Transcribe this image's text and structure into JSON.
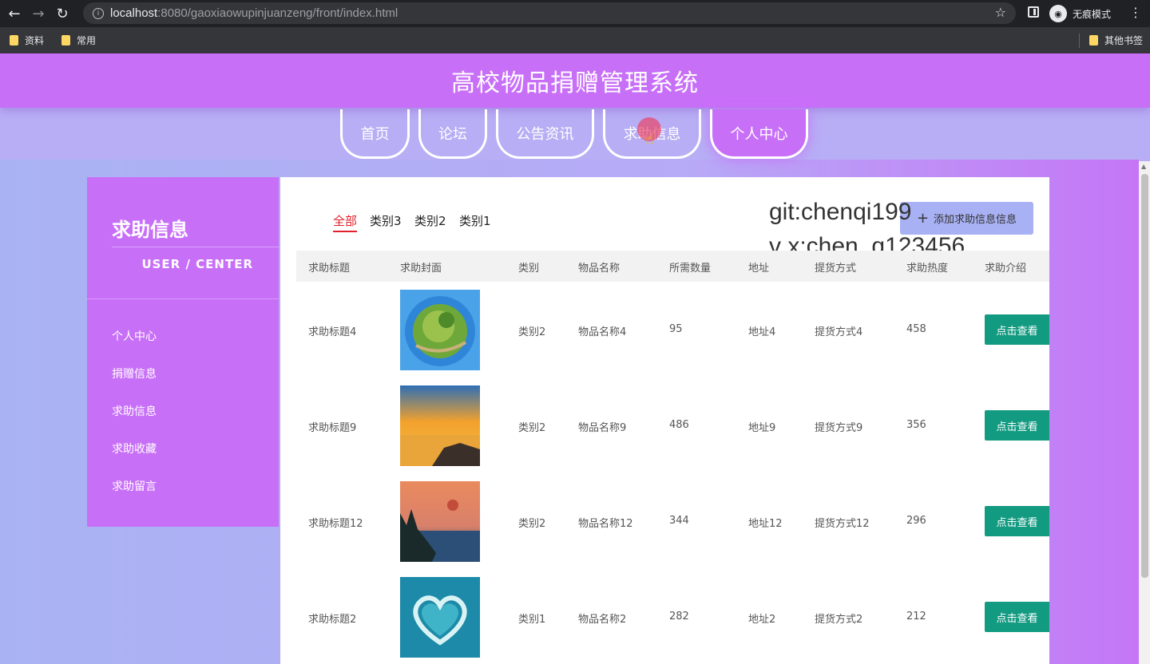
{
  "browser": {
    "url_host": "localhost",
    "url_rest": ":8080/gaoxiaowupinjuanzeng/front/index.html",
    "incognito_label": "无痕模式",
    "bookmarks": [
      "资料",
      "常用"
    ],
    "other_bookmarks": "其他书签"
  },
  "header": {
    "title": "高校物品捐赠管理系统"
  },
  "nav": {
    "tabs": [
      {
        "label": "首页"
      },
      {
        "label": "论坛"
      },
      {
        "label": "公告资讯"
      },
      {
        "label": "求助信息"
      },
      {
        "label": "个人中心",
        "active": true
      }
    ]
  },
  "sidebar": {
    "title": "求助信息",
    "subtitle": "USER / CENTER",
    "items": [
      "个人中心",
      "捐赠信息",
      "求助信息",
      "求助收藏",
      "求助留言"
    ]
  },
  "filters": {
    "items": [
      "全部",
      "类别3",
      "类别2",
      "类别1"
    ],
    "active": "全部"
  },
  "add_button": "添加求助信息信息",
  "watermark": {
    "line1": "git:chenqi199",
    "line2": "v x:chen_q123456"
  },
  "table": {
    "headers": [
      "求助标题",
      "求助封面",
      "类别",
      "物品名称",
      "所需数量",
      "地址",
      "提货方式",
      "求助热度",
      "求助介绍"
    ],
    "rows": [
      {
        "title": "求助标题4",
        "image": "planet",
        "category": "类别2",
        "name": "物品名称4",
        "qty": "95",
        "addr": "地址4",
        "pickup": "提货方式4",
        "heat": "458",
        "action": "点击查看"
      },
      {
        "title": "求助标题9",
        "image": "sunset",
        "category": "类别2",
        "name": "物品名称9",
        "qty": "486",
        "addr": "地址9",
        "pickup": "提货方式9",
        "heat": "356",
        "action": "点击查看"
      },
      {
        "title": "求助标题12",
        "image": "lake",
        "category": "类别2",
        "name": "物品名称12",
        "qty": "344",
        "addr": "地址12",
        "pickup": "提货方式12",
        "heat": "296",
        "action": "点击查看"
      },
      {
        "title": "求助标题2",
        "image": "heart-island",
        "category": "类别1",
        "name": "物品名称2",
        "qty": "282",
        "addr": "地址2",
        "pickup": "提货方式2",
        "heat": "212",
        "action": "点击查看"
      }
    ]
  },
  "colors": {
    "brand": "#c86ff8",
    "view_button": "#139b82",
    "add_button": "#a8b1f3",
    "filter_active": "#e0202a"
  }
}
